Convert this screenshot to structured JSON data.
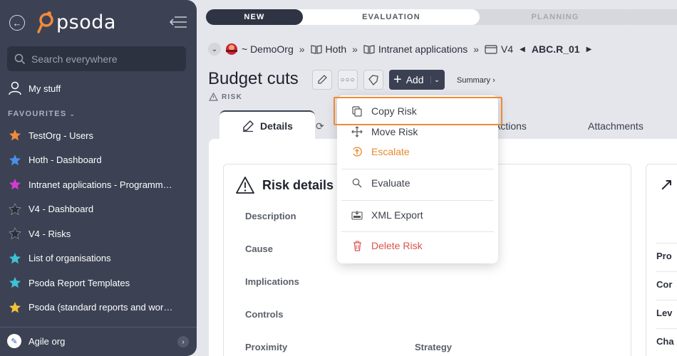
{
  "sidebar": {
    "logo_text": "psoda",
    "search_placeholder": "Search everywhere",
    "my_stuff": "My stuff",
    "favourites_heading": "FAVOURITES",
    "favourites": [
      {
        "label": "TestOrg - Users",
        "color": "#f28a3a"
      },
      {
        "label": "Hoth - Dashboard",
        "color": "#4a8fe8"
      },
      {
        "label": "Intranet applications - Programme...",
        "color": "#d63ad6"
      },
      {
        "label": "V4 - Dashboard",
        "color": "#2a2e38"
      },
      {
        "label": "V4 - Risks",
        "color": "#2a2e38"
      },
      {
        "label": "List of organisations",
        "color": "#3ec3d6"
      },
      {
        "label": "Psoda Report Templates",
        "color": "#3ec3d6"
      },
      {
        "label": "Psoda (standard reports and work...",
        "color": "#f2c23a"
      }
    ],
    "org": "Agile org"
  },
  "steps": {
    "new": "NEW",
    "evaluation": "EVALUATION",
    "planning": "PLANNING"
  },
  "breadcrumb": {
    "org": "~ DemoOrg",
    "item1": "Hoth",
    "item2": "Intranet applications",
    "item3": "V4",
    "current": "ABC.R_01"
  },
  "page": {
    "title": "Budget cuts",
    "add_label": "Add",
    "summary": "Summary ›",
    "type": "RISK"
  },
  "tabs": {
    "details": "Details",
    "actions": "Actions",
    "attachments": "Attachments"
  },
  "card": {
    "title": "Risk details",
    "fields": {
      "description": "Description",
      "cause": "Cause",
      "implications": "Implications",
      "controls": "Controls",
      "proximity": "Proximity",
      "strategy": "Strategy"
    }
  },
  "side_card": {
    "rows": [
      "Pro",
      "Cor",
      "Lev",
      "Cha"
    ]
  },
  "menu": {
    "copy": "Copy Risk",
    "move": "Move Risk",
    "escalate": "Escalate",
    "evaluate": "Evaluate",
    "xml_export": "XML Export",
    "delete": "Delete Risk"
  },
  "colors": {
    "sidebar_bg": "#3c4253",
    "accent_orange": "#e8892c",
    "danger_red": "#d9534f",
    "highlight_border": "#ef8a33"
  }
}
